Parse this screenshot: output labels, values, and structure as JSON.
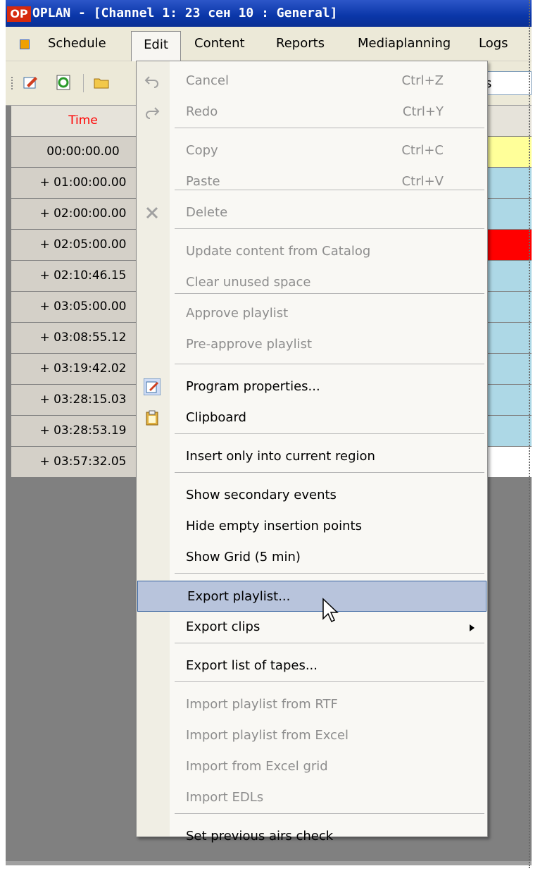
{
  "window": {
    "title": "OPLAN - [Channel 1: 23 сен 10 : General]",
    "logo_text": "OP"
  },
  "menubar": {
    "items": [
      {
        "label": "Schedule"
      },
      {
        "label": "Edit"
      },
      {
        "label": "Content"
      },
      {
        "label": "Reports"
      },
      {
        "label": "Mediaplanning"
      },
      {
        "label": "Logs"
      }
    ]
  },
  "toolbar": {
    "combo_text": "s",
    "buttons": [
      "properties-icon",
      "refresh-icon",
      "folder-icon"
    ]
  },
  "grid": {
    "header_time": "Time",
    "header_color": "#ff0000",
    "rows": [
      {
        "time": "00:00:00.00",
        "color": "#ffff99"
      },
      {
        "time": "+ 01:00:00.00",
        "color": "#add8e6"
      },
      {
        "time": "+ 02:00:00.00",
        "color": "#add8e6"
      },
      {
        "time": "+ 02:05:00.00",
        "color": "#ff0000"
      },
      {
        "time": "+ 02:10:46.15",
        "color": "#add8e6"
      },
      {
        "time": "+ 03:05:00.00",
        "color": "#add8e6"
      },
      {
        "time": "+ 03:08:55.12",
        "color": "#add8e6"
      },
      {
        "time": "+ 03:19:42.02",
        "color": "#add8e6"
      },
      {
        "time": "+ 03:28:15.03",
        "color": "#add8e6"
      },
      {
        "time": "+ 03:28:53.19",
        "color": "#add8e6"
      },
      {
        "time": "+ 03:57:32.05",
        "color": "#ffffff"
      }
    ]
  },
  "edit_menu": {
    "items": [
      {
        "label": "Cancel",
        "shortcut": "Ctrl+Z",
        "enabled": false,
        "icon": "undo-icon"
      },
      {
        "label": "Redo",
        "shortcut": "Ctrl+Y",
        "enabled": false,
        "icon": "redo-icon"
      },
      {
        "label": "Copy",
        "shortcut": "Ctrl+C",
        "enabled": false
      },
      {
        "label": "Paste",
        "shortcut": "Ctrl+V",
        "enabled": false
      },
      {
        "label": "Delete",
        "enabled": false,
        "icon": "delete-icon"
      },
      {
        "label": "Update content from Catalog",
        "enabled": false
      },
      {
        "label": "Clear unused space",
        "enabled": false
      },
      {
        "label": "Approve playlist",
        "enabled": false
      },
      {
        "label": "Pre-approve playlist",
        "enabled": false
      },
      {
        "label": "Program properties...",
        "enabled": true,
        "icon": "program-properties-icon"
      },
      {
        "label": "Clipboard",
        "enabled": true,
        "icon": "clipboard-icon"
      },
      {
        "label": "Insert only into current region",
        "enabled": true
      },
      {
        "label": "Show secondary events",
        "enabled": true
      },
      {
        "label": "Hide empty insertion points",
        "enabled": true
      },
      {
        "label": "Show Grid (5 min)",
        "enabled": true
      },
      {
        "label": "Export playlist...",
        "enabled": true,
        "highlighted": true
      },
      {
        "label": "Export clips",
        "enabled": true,
        "submenu": true
      },
      {
        "label": "Export list of tapes...",
        "enabled": true
      },
      {
        "label": "Import playlist from RTF",
        "enabled": false
      },
      {
        "label": "Import playlist from Excel",
        "enabled": false
      },
      {
        "label": "Import from Excel grid",
        "enabled": false
      },
      {
        "label": "Import EDLs",
        "enabled": false
      },
      {
        "label": "Set previous airs check",
        "enabled": true
      }
    ]
  },
  "colors": {
    "highlight": "#b8c4dc",
    "highlight_border": "#34609e",
    "disabled_text": "#8d8d8d"
  }
}
